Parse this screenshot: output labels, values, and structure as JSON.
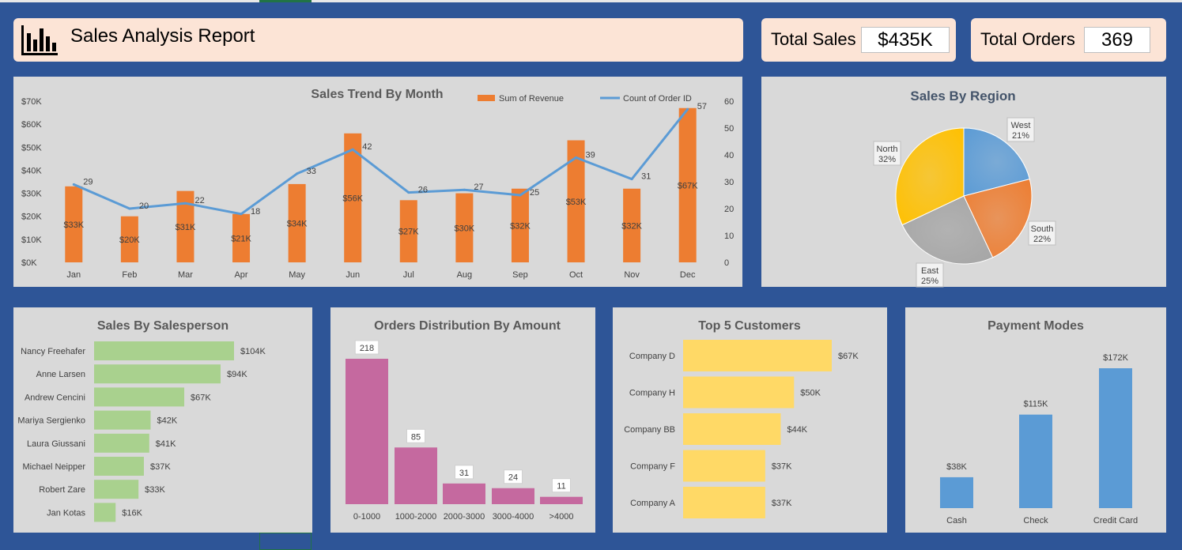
{
  "header": {
    "title": "Sales Analysis Report",
    "icon": "bar-chart-icon"
  },
  "kpis": {
    "total_sales_label": "Total Sales",
    "total_sales_value": "$435K",
    "total_orders_label": "Total Orders",
    "total_orders_value": "369"
  },
  "colors": {
    "background": "#2e5597",
    "panel": "#d9d9d9",
    "header": "#fce4d6",
    "orange": "#ed7d31",
    "blue": "#5b9bd5",
    "green": "#a9d18e",
    "pink": "#c5699f",
    "yellow": "#ffd966"
  },
  "chart_data": [
    {
      "id": "trend",
      "type": "bar",
      "title": "Sales Trend By Month",
      "categories": [
        "Jan",
        "Feb",
        "Mar",
        "Apr",
        "May",
        "Jun",
        "Jul",
        "Aug",
        "Sep",
        "Oct",
        "Nov",
        "Dec"
      ],
      "series": [
        {
          "name": "Sum of Revenue",
          "type": "bar",
          "axis": "left",
          "values": [
            33000,
            20000,
            31000,
            21000,
            34000,
            56000,
            27000,
            30000,
            32000,
            53000,
            32000,
            67000
          ],
          "labels": [
            "$33K",
            "$20K",
            "$31K",
            "$21K",
            "$34K",
            "$56K",
            "$27K",
            "$30K",
            "$32K",
            "$53K",
            "$32K",
            "$67K"
          ]
        },
        {
          "name": "Count of Order ID",
          "type": "line",
          "axis": "right",
          "values": [
            29,
            20,
            22,
            18,
            33,
            42,
            26,
            27,
            25,
            39,
            31,
            57
          ]
        }
      ],
      "ylim": [
        0,
        70000
      ],
      "yticks": [
        "$0K",
        "$10K",
        "$20K",
        "$30K",
        "$40K",
        "$50K",
        "$60K",
        "$70K"
      ],
      "y2lim": [
        0,
        60
      ],
      "y2ticks": [
        "0",
        "10",
        "20",
        "30",
        "40",
        "50",
        "60"
      ],
      "legend": "top-right",
      "grid": false
    },
    {
      "id": "region",
      "type": "pie",
      "title": "Sales By Region",
      "labels": [
        "West",
        "South",
        "East",
        "North"
      ],
      "values": [
        21,
        22,
        25,
        32
      ],
      "value_labels": [
        "21%",
        "22%",
        "25%",
        "32%"
      ]
    },
    {
      "id": "salesperson",
      "type": "bar",
      "orientation": "horizontal",
      "title": "Sales By Salesperson",
      "categories": [
        "Nancy Freehafer",
        "Anne Larsen",
        "Andrew Cencini",
        "Mariya Sergienko",
        "Laura Giussani",
        "Michael Neipper",
        "Robert Zare",
        "Jan Kotas"
      ],
      "values": [
        104000,
        94000,
        67000,
        42000,
        41000,
        37000,
        33000,
        16000
      ],
      "labels": [
        "$104K",
        "$94K",
        "$67K",
        "$42K",
        "$41K",
        "$37K",
        "$33K",
        "$16K"
      ]
    },
    {
      "id": "distribution",
      "type": "bar",
      "title": "Orders Distribution By Amount",
      "categories": [
        "0-1000",
        "1000-2000",
        "2000-3000",
        "3000-4000",
        ">4000"
      ],
      "values": [
        218,
        85,
        31,
        24,
        11
      ],
      "labels": [
        "218",
        "85",
        "31",
        "24",
        "11"
      ]
    },
    {
      "id": "customers",
      "type": "bar",
      "orientation": "horizontal",
      "title": "Top 5 Customers",
      "categories": [
        "Company D",
        "Company H",
        "Company BB",
        "Company F",
        "Company A"
      ],
      "values": [
        67000,
        50000,
        44000,
        37000,
        37000
      ],
      "labels": [
        "$67K",
        "$50K",
        "$44K",
        "$37K",
        "$37K"
      ]
    },
    {
      "id": "payment",
      "type": "bar",
      "title": "Payment Modes",
      "categories": [
        "Cash",
        "Check",
        "Credit Card"
      ],
      "values": [
        38000,
        115000,
        172000
      ],
      "labels": [
        "$38K",
        "$115K",
        "$172K"
      ]
    }
  ]
}
